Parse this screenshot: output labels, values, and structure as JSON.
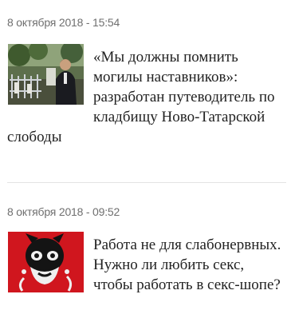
{
  "news": [
    {
      "date": "8 октября 2018 - 15:54",
      "thumbnail_icon": "cemetery-man-photo",
      "headline": "«Мы должны помнить могилы наставников»: разработан путеводитель по кладбищу Ново-Татарской слободы"
    },
    {
      "date": "8 октября 2018 - 09:52",
      "thumbnail_icon": "red-masked-figure-photo",
      "headline": "Работа не для слабонервных. Нужно ли любить секс, чтобы работать в секс-шопе?"
    }
  ],
  "colors": {
    "date_text": "#6f6f6f",
    "headline_text": "#222222",
    "divider": "#e3e3e3",
    "thumb2_background": "#d0161e"
  }
}
